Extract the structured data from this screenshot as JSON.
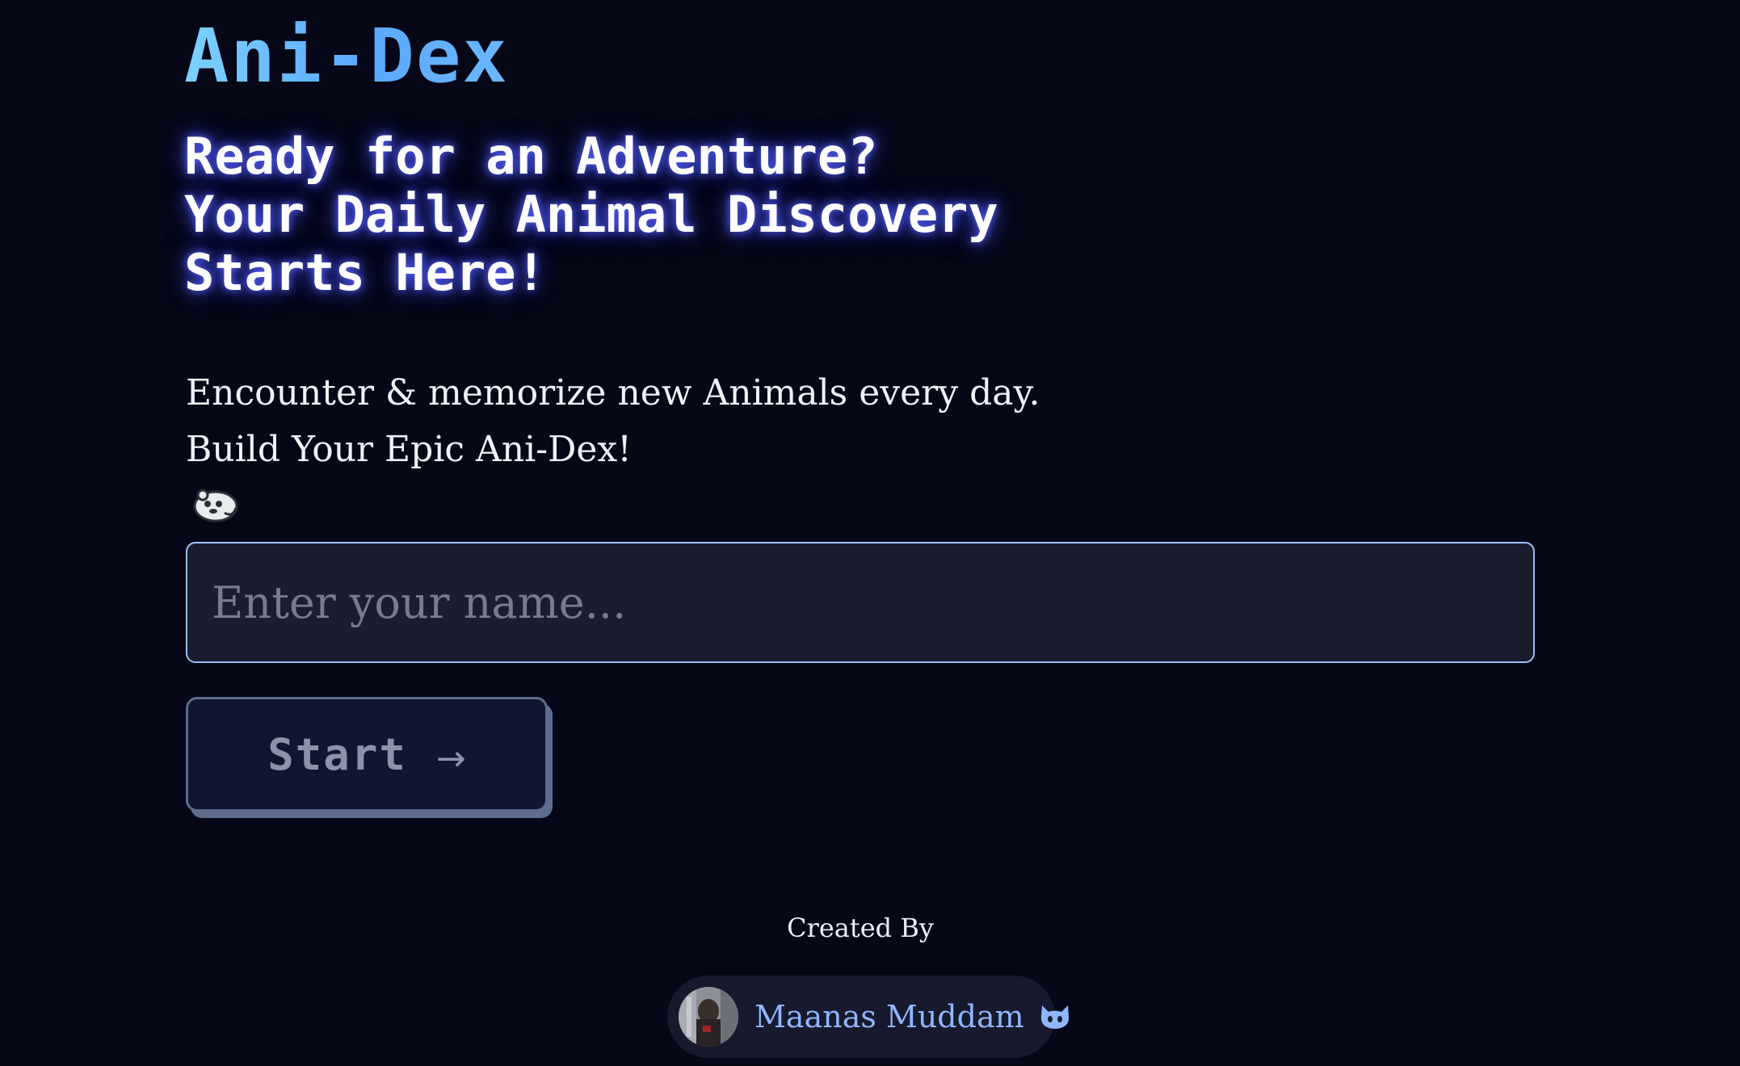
{
  "app": {
    "logo": "Ani-Dex"
  },
  "hero": {
    "headline_lines": [
      "Ready for an Adventure?",
      "Your Daily Animal Discovery",
      "Starts Here!"
    ],
    "intro_lines": [
      "Encounter & memorize new Animals every day.",
      "Build Your Epic Ani-Dex!"
    ],
    "intro_emoji_icon": "otter-emoji-icon"
  },
  "form": {
    "name_value": "",
    "name_placeholder": "Enter your name...",
    "start_label": "Start",
    "start_arrow": "→"
  },
  "footer": {
    "created_by": "Created By",
    "author_name": "Maanas Muddam",
    "author_link_icon": "github-icon"
  },
  "colors": {
    "background": "#060817",
    "logo_gradient_start": "#7cd2ff",
    "logo_gradient_end": "#5aa8ff",
    "headline_glow": "#5a64ff",
    "input_background": "#1b1c2e",
    "input_border": "#9dbfff",
    "button_background": "#101530",
    "button_border": "#5c6d8d",
    "author_link": "#8fb6ff"
  }
}
